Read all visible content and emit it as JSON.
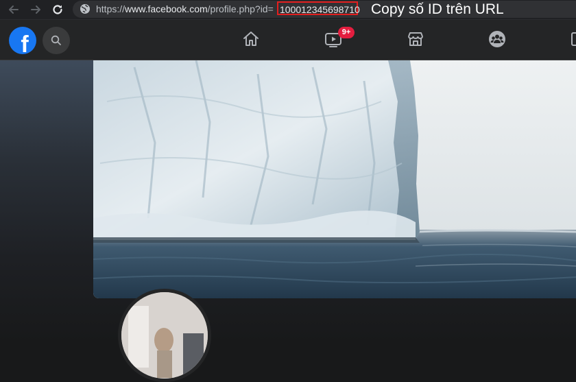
{
  "browser": {
    "url_prefix": "https://",
    "url_host": "www.facebook.com",
    "url_path": "/profile.php?id=",
    "profile_id": "100012345698710",
    "icons": {
      "back": "arrow-left-icon",
      "forward": "arrow-right-icon",
      "reload": "reload-icon",
      "site_info": "globe-icon"
    }
  },
  "annotation": {
    "text": "Copy số ID trên URL",
    "highlight_color": "#e41e1e"
  },
  "facebook": {
    "brand_color": "#1877f2",
    "logo_letter": "f",
    "icons": {
      "logo": "facebook-logo-icon",
      "search": "search-icon",
      "home": "home-icon",
      "watch": "video-icon",
      "marketplace": "store-icon",
      "groups": "groups-icon",
      "gaming": "gaming-icon"
    },
    "watch_badge": "9+",
    "badge_color": "#e41e3f"
  }
}
